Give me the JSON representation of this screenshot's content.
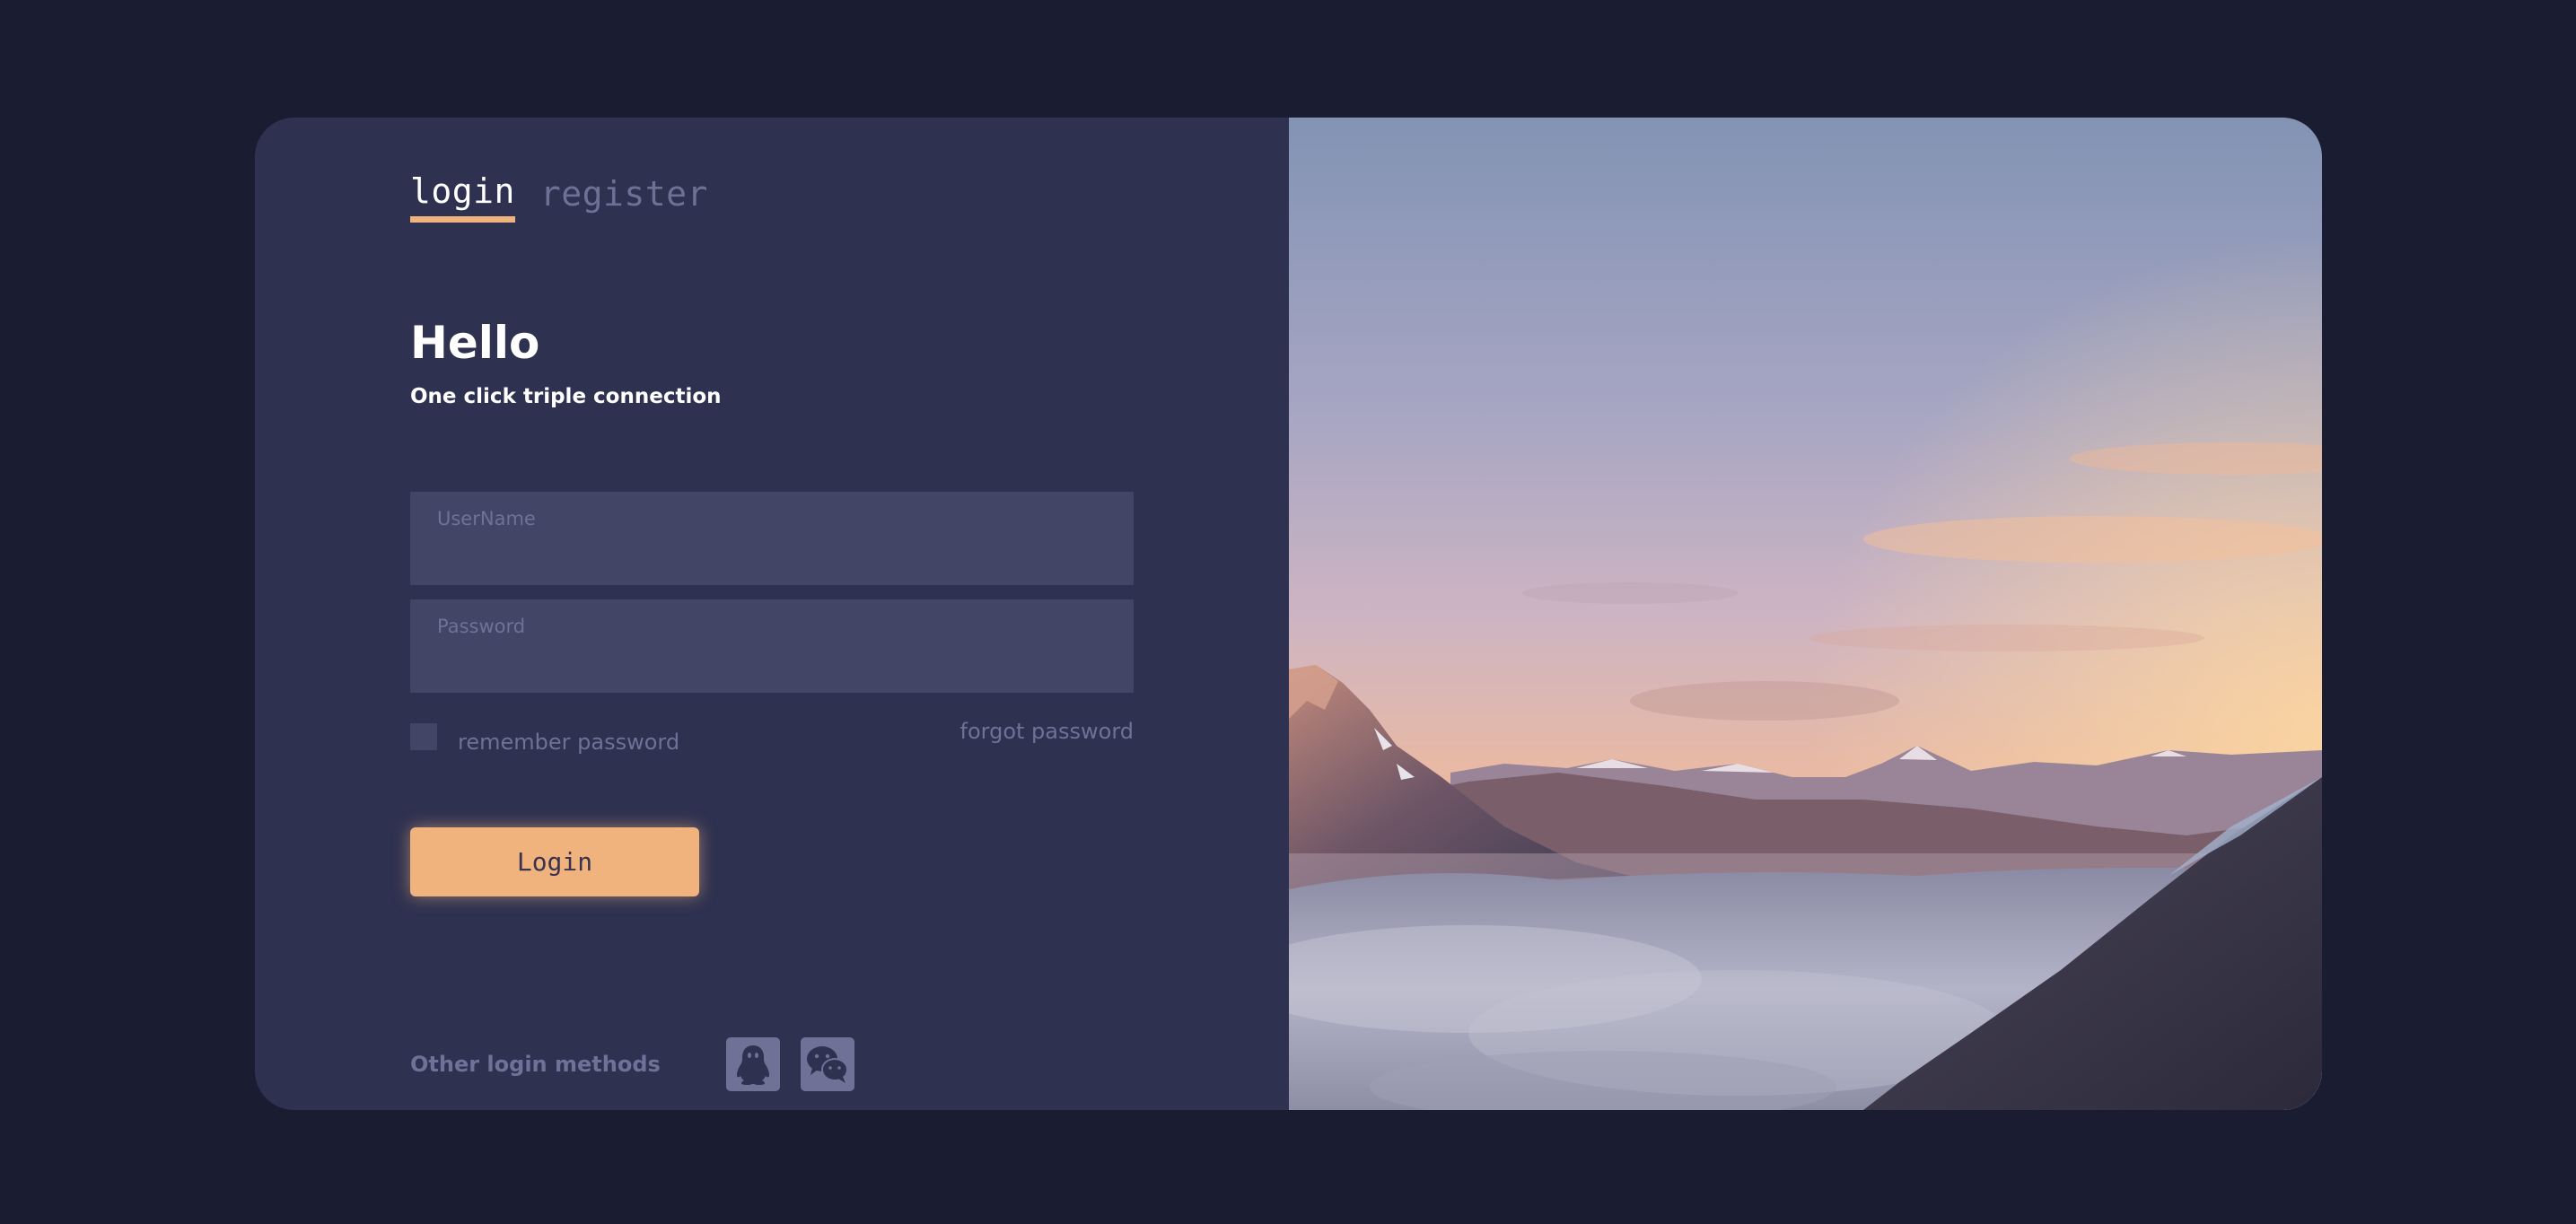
{
  "tabs": [
    {
      "label": "login",
      "active": true
    },
    {
      "label": "register",
      "active": false
    }
  ],
  "heading": "Hello",
  "subheading": "One click triple connection",
  "fields": {
    "username": {
      "placeholder": "UserName",
      "value": ""
    },
    "password": {
      "placeholder": "Password",
      "value": ""
    }
  },
  "remember_label": "remember password",
  "forgot_label": "forgot password",
  "login_button": "Login",
  "other_methods_label": "Other login methods",
  "social": [
    {
      "icon": "qq-penguin-icon"
    },
    {
      "icon": "wechat-icon"
    }
  ],
  "colors": {
    "background": "#1a1d31",
    "card": "#2e3150",
    "input": "#424565",
    "accent": "#f0b37d",
    "muted": "#6f7196"
  },
  "illustration": "mountain-sunset-photo"
}
